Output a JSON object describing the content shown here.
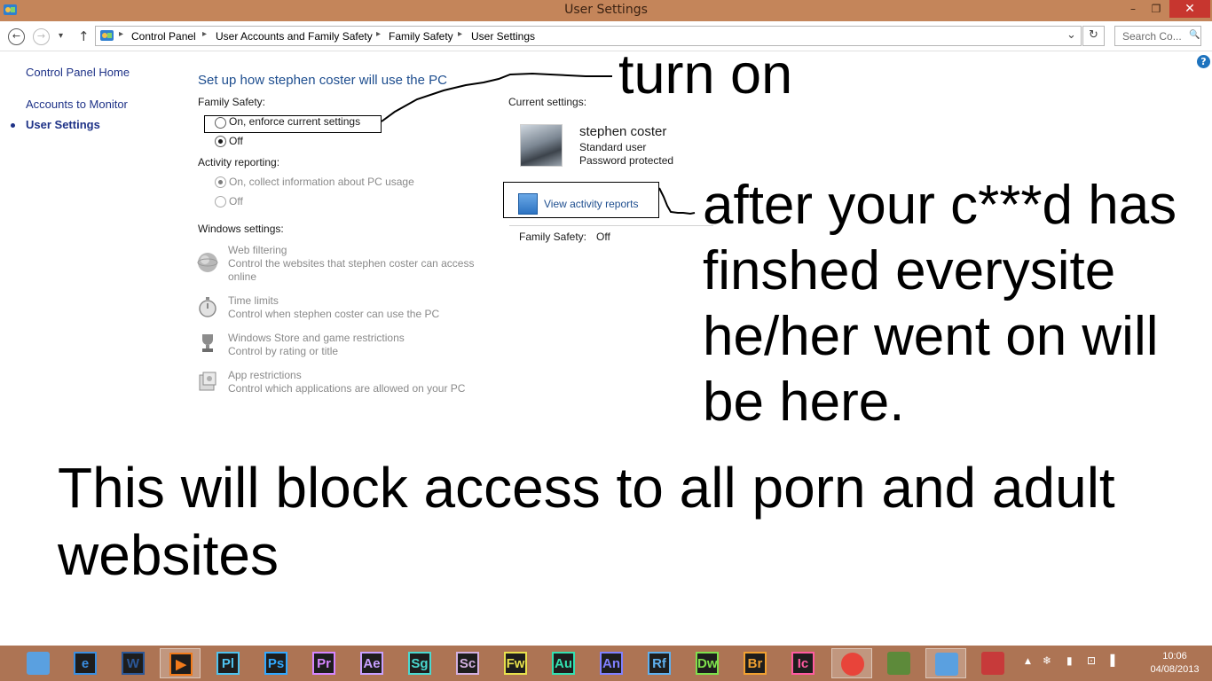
{
  "window": {
    "title": "User Settings",
    "buttons": {
      "minimize": "–",
      "maximize": "❐",
      "close": "✕"
    }
  },
  "addressbar": {
    "back": "←",
    "forward": "→",
    "recent": "▾",
    "up": "↑",
    "breadcrumbs": [
      "Control Panel",
      "User Accounts and Family Safety",
      "Family Safety",
      "User Settings"
    ],
    "separator": "▸",
    "dropdown": "⌄",
    "refresh": "↻",
    "search_placeholder": "Search Co...",
    "search_icon": "🔍"
  },
  "help": "?",
  "sidebar": {
    "items": [
      {
        "label": "Control Panel Home",
        "active": false
      },
      {
        "label": "Accounts to Monitor",
        "active": false
      },
      {
        "label": "User Settings",
        "active": true
      }
    ]
  },
  "main": {
    "heading": "Set up how stephen coster will use the PC",
    "family_safety": {
      "label": "Family Safety:",
      "options": [
        {
          "label": "On, enforce current settings",
          "checked": false
        },
        {
          "label": "Off",
          "checked": true
        }
      ]
    },
    "activity_reporting": {
      "label": "Activity reporting:",
      "options": [
        {
          "label": "On, collect information about PC usage",
          "checked": true
        },
        {
          "label": "Off",
          "checked": false
        }
      ]
    },
    "windows_settings": {
      "label": "Windows settings:",
      "items": [
        {
          "title": "Web filtering",
          "desc1": "Control the websites that stephen coster can access",
          "desc2": "online",
          "icon": "globe-icon"
        },
        {
          "title": "Time limits",
          "desc1": "Control when stephen coster can use the PC",
          "desc2": "",
          "icon": "stopwatch-icon"
        },
        {
          "title": "Windows Store and game restrictions",
          "desc1": "Control by rating or title",
          "desc2": "",
          "icon": "trophy-icon"
        },
        {
          "title": "App restrictions",
          "desc1": "Control which applications are allowed on your PC",
          "desc2": "",
          "icon": "app-restrictions-icon"
        }
      ]
    },
    "current_settings": {
      "label": "Current settings:",
      "user_name": "stephen coster",
      "account_type": "Standard user",
      "password_status": "Password protected",
      "view_reports": "View activity reports",
      "family_safety_label": "Family Safety:",
      "family_safety_value": "Off"
    }
  },
  "annotations": {
    "turn_on": "turn on",
    "reports_note": [
      "after your c***d has",
      "finshed everysite",
      "he/her went on will",
      "be here."
    ],
    "block_note": [
      "This will block access to all porn and adult",
      "websites"
    ]
  },
  "taskbar": {
    "apps": [
      {
        "name": "control-panel-app",
        "label": "",
        "color": "#5aa0e0",
        "active": false
      },
      {
        "name": "internet-explorer-app",
        "label": "e",
        "color": "#3a8ee0",
        "active": false
      },
      {
        "name": "word-app",
        "label": "W",
        "color": "#2b5797",
        "active": false
      },
      {
        "name": "media-player-app",
        "label": "▶",
        "color": "#f07a1a",
        "active": true
      },
      {
        "name": "prelude-app",
        "label": "Pl",
        "color": "#4ec2ee",
        "active": false
      },
      {
        "name": "photoshop-app",
        "label": "Ps",
        "color": "#31a8ff",
        "active": false
      },
      {
        "name": "premiere-app",
        "label": "Pr",
        "color": "#d585ff",
        "active": false
      },
      {
        "name": "after-effects-app",
        "label": "Ae",
        "color": "#c8a0ff",
        "active": false
      },
      {
        "name": "speedgrade-app",
        "label": "Sg",
        "color": "#4ad9d0",
        "active": false
      },
      {
        "name": "scout-app",
        "label": "Sc",
        "color": "#d3b0e0",
        "active": false
      },
      {
        "name": "fireworks-app",
        "label": "Fw",
        "color": "#e8e04c",
        "active": false
      },
      {
        "name": "audition-app",
        "label": "Au",
        "color": "#33e0b0",
        "active": false
      },
      {
        "name": "animate-app",
        "label": "An",
        "color": "#8080ff",
        "active": false
      },
      {
        "name": "reflow-app",
        "label": "Rf",
        "color": "#5fb0ee",
        "active": false
      },
      {
        "name": "dreamweaver-app",
        "label": "Dw",
        "color": "#7ee04c",
        "active": false
      },
      {
        "name": "bridge-app",
        "label": "Br",
        "color": "#f0a030",
        "active": false
      },
      {
        "name": "incopy-app",
        "label": "Ic",
        "color": "#ff5aa0",
        "active": false
      },
      {
        "name": "chrome-app",
        "label": "",
        "color": "#e8443a",
        "active": true
      },
      {
        "name": "minecraft-app",
        "label": "",
        "color": "#5d8a3a",
        "active": false
      },
      {
        "name": "control-panel-window",
        "label": "",
        "color": "#5aa0e0",
        "active": true
      },
      {
        "name": "snipping-tool-app",
        "label": "",
        "color": "#c73a3a",
        "active": false
      }
    ],
    "tray": {
      "chevron": "▲",
      "icons": [
        "❄",
        "▮",
        "⊡",
        "▐"
      ]
    },
    "time": "10:06",
    "date": "04/08/2013"
  }
}
